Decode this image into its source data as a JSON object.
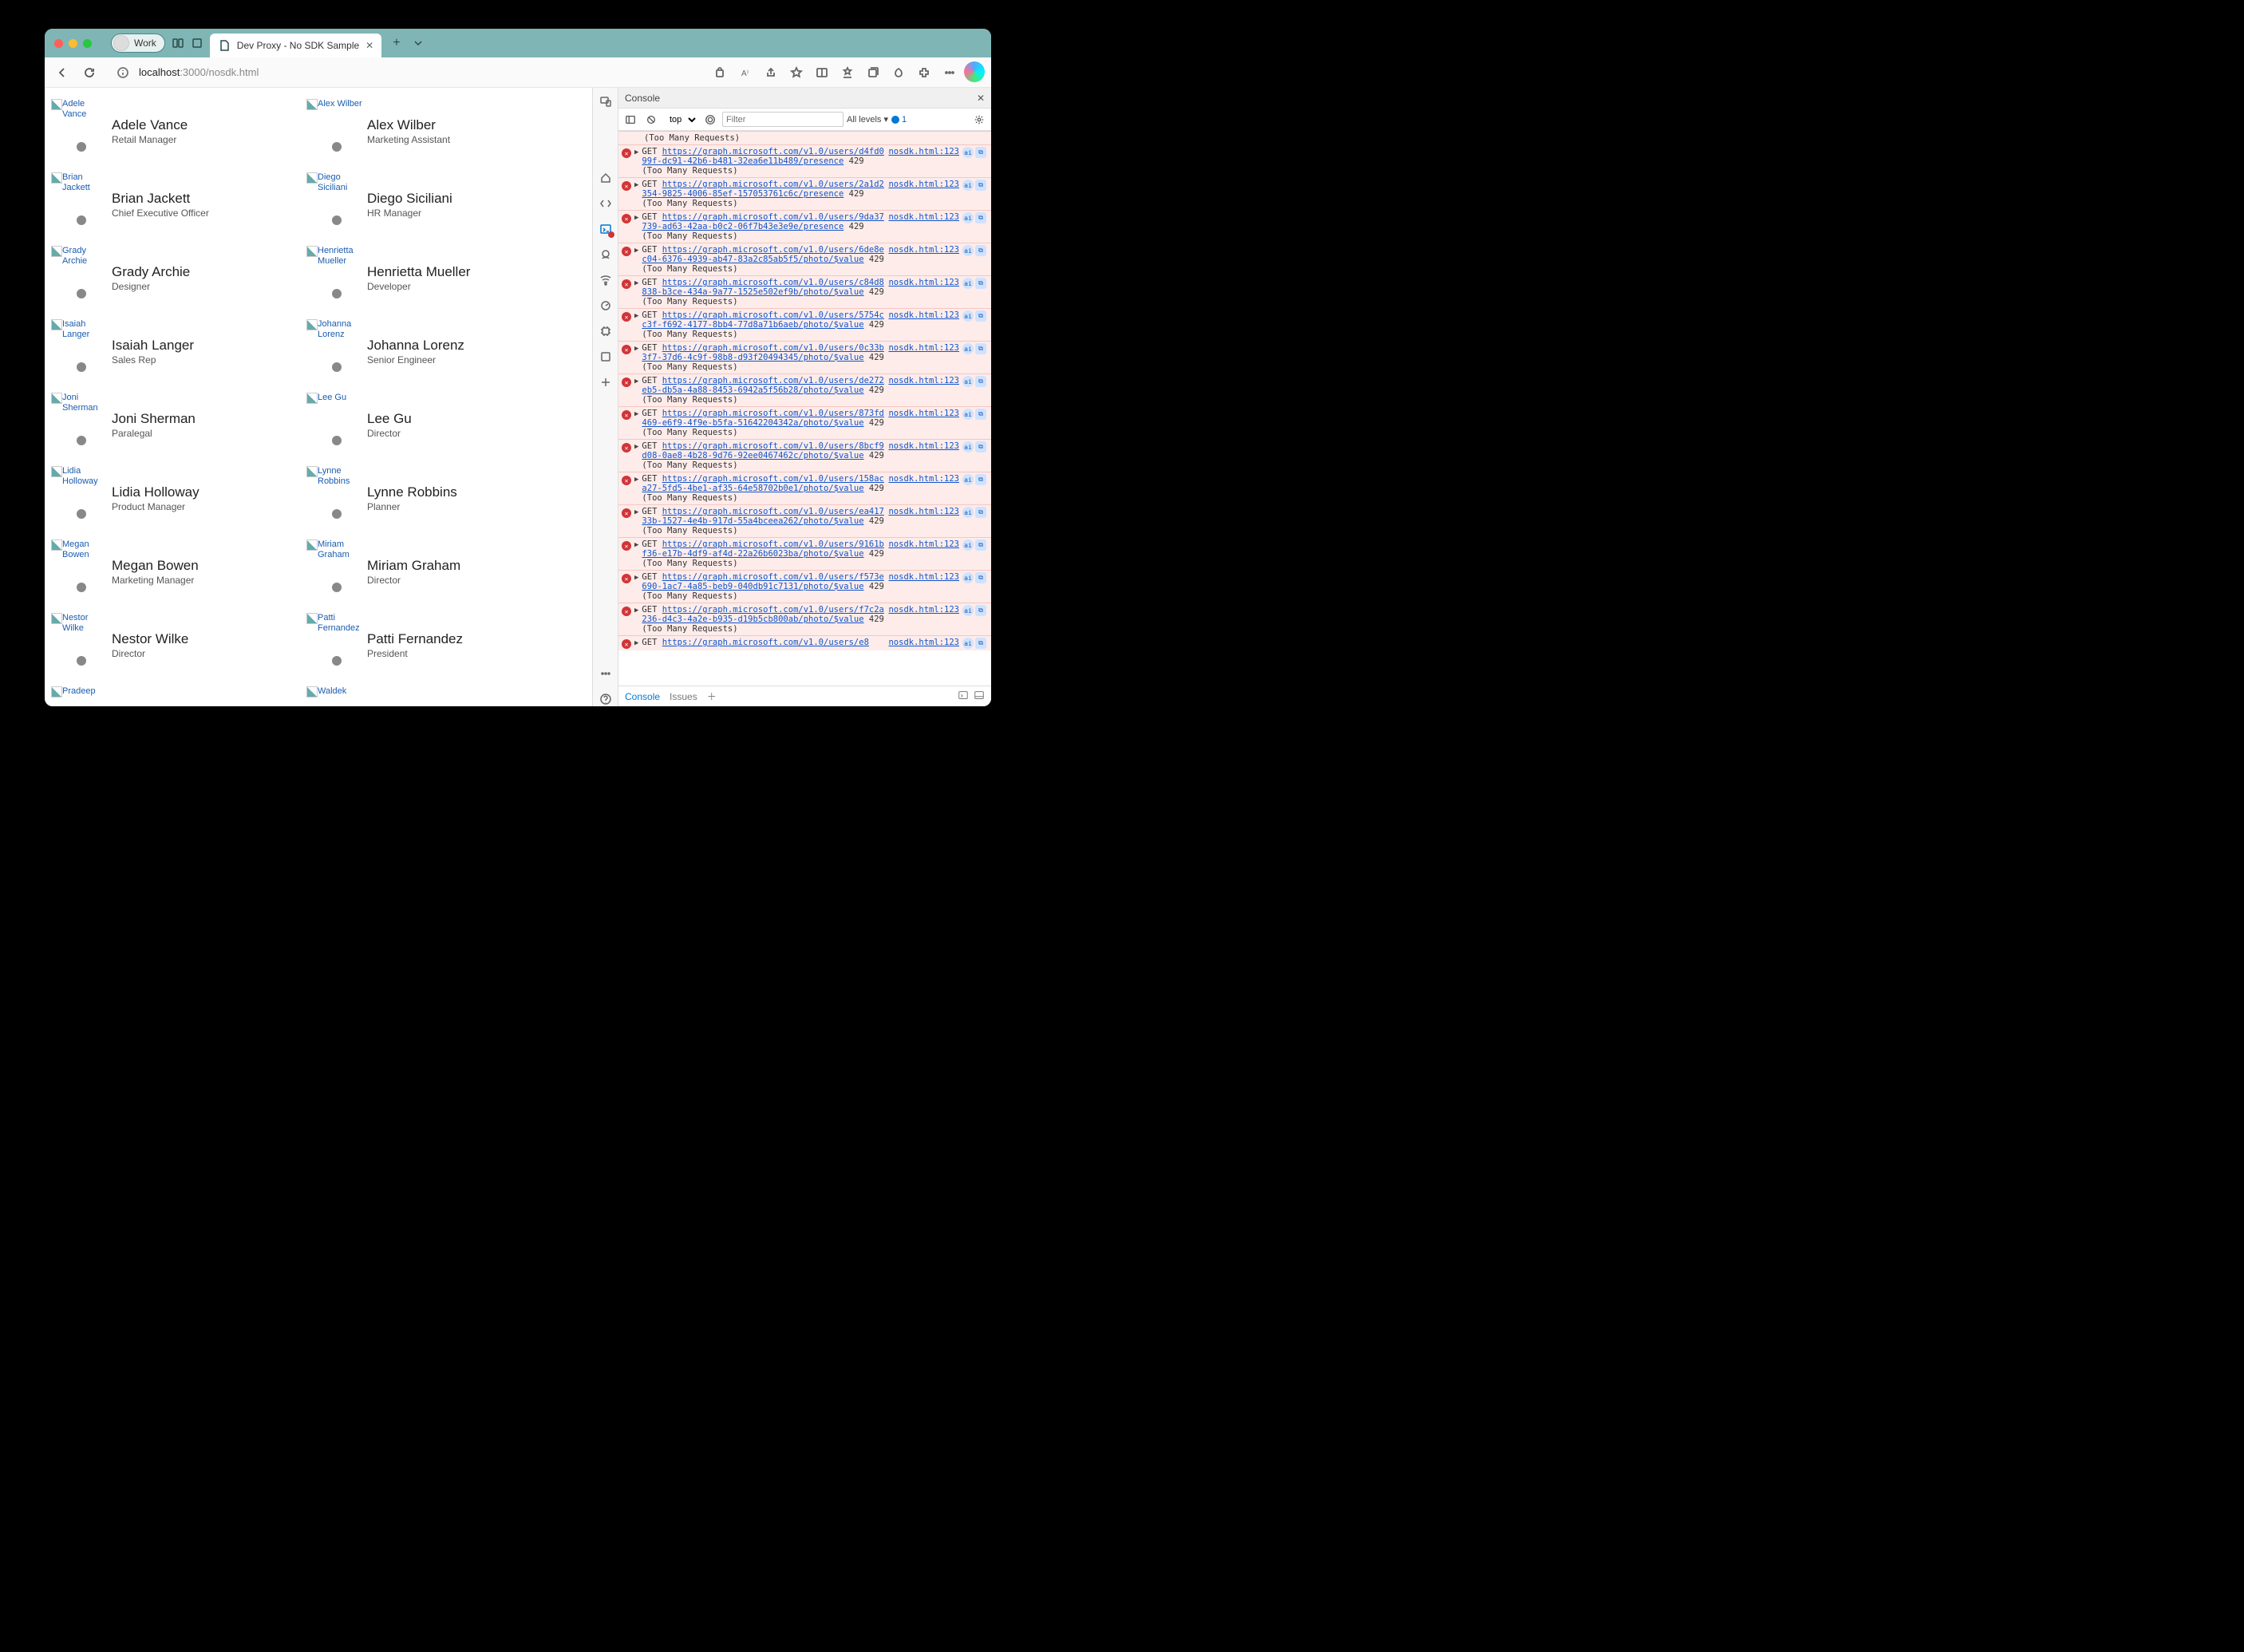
{
  "titlebar": {
    "profile_label": "Work",
    "tab_title": "Dev Proxy - No SDK Sample"
  },
  "toolbar": {
    "url_host": "localhost",
    "url_port": ":3000",
    "url_path": "/nosdk.html"
  },
  "people": [
    {
      "photo": "Adele Vance",
      "name": "Adele Vance",
      "title": "Retail Manager"
    },
    {
      "photo": "Alex Wilber",
      "name": "Alex Wilber",
      "title": "Marketing Assistant"
    },
    {
      "photo": "Brian Jackett",
      "name": "Brian Jackett",
      "title": "Chief Executive Officer"
    },
    {
      "photo": "Diego Siciliani",
      "name": "Diego Siciliani",
      "title": "HR Manager"
    },
    {
      "photo": "Grady Archie",
      "name": "Grady Archie",
      "title": "Designer"
    },
    {
      "photo": "Henrietta Mueller",
      "name": "Henrietta Mueller",
      "title": "Developer"
    },
    {
      "photo": "Isaiah Langer",
      "name": "Isaiah Langer",
      "title": "Sales Rep"
    },
    {
      "photo": "Johanna Lorenz",
      "name": "Johanna Lorenz",
      "title": "Senior Engineer"
    },
    {
      "photo": "Joni Sherman",
      "name": "Joni Sherman",
      "title": "Paralegal"
    },
    {
      "photo": "Lee Gu",
      "name": "Lee Gu",
      "title": "Director"
    },
    {
      "photo": "Lidia Holloway",
      "name": "Lidia Holloway",
      "title": "Product Manager"
    },
    {
      "photo": "Lynne Robbins",
      "name": "Lynne Robbins",
      "title": "Planner"
    },
    {
      "photo": "Megan Bowen",
      "name": "Megan Bowen",
      "title": "Marketing Manager"
    },
    {
      "photo": "Miriam Graham",
      "name": "Miriam Graham",
      "title": "Director"
    },
    {
      "photo": "Nestor Wilke",
      "name": "Nestor Wilke",
      "title": "Director"
    },
    {
      "photo": "Patti Fernandez",
      "name": "Patti Fernandez",
      "title": "President"
    },
    {
      "photo": "Pradeep",
      "name": "",
      "title": ""
    },
    {
      "photo": "Waldek",
      "name": "",
      "title": ""
    }
  ],
  "devtools": {
    "panel_title": "Console",
    "context": "top",
    "filter_placeholder": "Filter",
    "levels": "All levels ▾",
    "issue_count": "1",
    "footer_tab1": "Console",
    "footer_tab2": "Issues",
    "top_remnant": "(Too Many Requests)",
    "logs": [
      {
        "url": "https://graph.microsoft.com/v1.0/users/d4fd099f-dc91-42b6-b481-32ea6e11b489/presence",
        "code": "429",
        "text": "(Too Many Requests)",
        "src": "nosdk.html:123",
        "inline": false
      },
      {
        "url": "https://graph.microsoft.com/v1.0/users/2a1d2354-9825-4006-85ef-157053761c6c/presence",
        "code": "429",
        "text": "(Too Many Requests)",
        "src": "nosdk.html:123",
        "inline": false
      },
      {
        "url": "https://graph.microsoft.com/v1.0/users/9da37739-ad63-42aa-b0c2-06f7b43e3e9e/presence",
        "code": "429",
        "text": "(Too Many Requests)",
        "src": "nosdk.html:123",
        "inline": false
      },
      {
        "url": "https://graph.microsoft.com/v1.0/users/6de8ec04-6376-4939-ab47-83a2c85ab5f5/photo/$value",
        "code": "429",
        "text": "(Too Many Requests)",
        "src": "nosdk.html:123",
        "inline": true
      },
      {
        "url": "https://graph.microsoft.com/v1.0/users/c84d8838-b3ce-434a-9a77-1525e502ef9b/photo/$value",
        "code": "429",
        "text": "(Too Many Requests)",
        "src": "nosdk.html:123",
        "inline": true
      },
      {
        "url": "https://graph.microsoft.com/v1.0/users/5754cc3f-f692-4177-8bb4-77d8a71b6aeb/photo/$value",
        "code": "429",
        "text": "(Too Many Requests)",
        "src": "nosdk.html:123",
        "inline": true
      },
      {
        "url": "https://graph.microsoft.com/v1.0/users/0c33b3f7-37d6-4c9f-98b8-d93f20494345/photo/$value",
        "code": "429",
        "text": "(Too Many Requests)",
        "src": "nosdk.html:123",
        "inline": true
      },
      {
        "url": "https://graph.microsoft.com/v1.0/users/de272eb5-db5a-4a88-8453-6942a5f56b28/photo/$value",
        "code": "429",
        "text": "(Too Many Requests)",
        "src": "nosdk.html:123",
        "inline": true
      },
      {
        "url": "https://graph.microsoft.com/v1.0/users/873fd469-e6f9-4f9e-b5fa-51642204342a/photo/$value",
        "code": "429",
        "text": "(Too Many Requests)",
        "src": "nosdk.html:123",
        "inline": true
      },
      {
        "url": "https://graph.microsoft.com/v1.0/users/8bcf9d08-0ae8-4b28-9d76-92ee0467462c/photo/$value",
        "code": "429",
        "text": "(Too Many Requests)",
        "src": "nosdk.html:123",
        "inline": true
      },
      {
        "url": "https://graph.microsoft.com/v1.0/users/158aca27-5fd5-4be1-af35-64e58702b0e1/photo/$value",
        "code": "429",
        "text": "(Too Many Requests)",
        "src": "nosdk.html:123",
        "inline": true
      },
      {
        "url": "https://graph.microsoft.com/v1.0/users/ea41733b-1527-4e4b-917d-55a4bceea262/photo/$value",
        "code": "429",
        "text": "(Too Many Requests)",
        "src": "nosdk.html:123",
        "inline": true
      },
      {
        "url": "https://graph.microsoft.com/v1.0/users/9161bf36-e17b-4df9-af4d-22a26b6023ba/photo/$value",
        "code": "429",
        "text": "(Too Many Requests)",
        "src": "nosdk.html:123",
        "inline": true
      },
      {
        "url": "https://graph.microsoft.com/v1.0/users/f573e690-1ac7-4a85-beb9-040db91c7131/photo/$value",
        "code": "429",
        "text": "(Too Many Requests)",
        "src": "nosdk.html:123",
        "inline": true
      },
      {
        "url": "https://graph.microsoft.com/v1.0/users/f7c2a236-d4c3-4a2e-b935-d19b5cb800ab/photo/$value",
        "code": "429",
        "text": "(Too Many Requests)",
        "src": "nosdk.html:123",
        "inline": true
      },
      {
        "url": "https://graph.microsoft.com/v1.0/users/e8",
        "code": "",
        "text": "",
        "src": "nosdk.html:123",
        "inline": true
      }
    ]
  }
}
